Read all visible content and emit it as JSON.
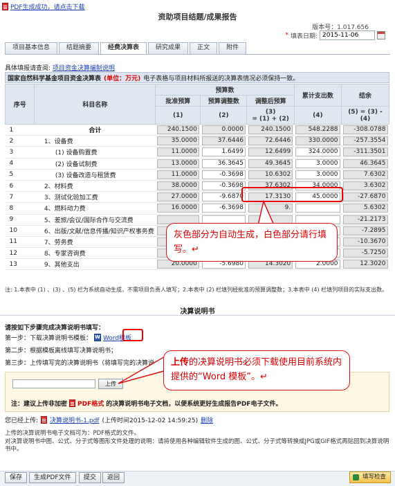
{
  "top_link": "PDF生成成功，请点击下载",
  "title": "资助项目结题/成果报告",
  "version": "版本号：1.017.656",
  "fill_date": {
    "required_mark": "*",
    "label": "填表日期:",
    "value": "2015-11-06"
  },
  "tabs": [
    "项目基本信息",
    "结题摘要",
    "经费决算表",
    "研究成果",
    "正文",
    "附件"
  ],
  "active_tab": 2,
  "guide": {
    "label": "具体填报请查阅:",
    "link": "项目资金决算编制说明"
  },
  "section": {
    "title": "国家自然科学基金项目资金决算表",
    "unit": "(单位：万元)",
    "desc": "电子表格与项目材料所报送的决算表情况必须保持一致。"
  },
  "table": {
    "headers": {
      "no": "序号",
      "name": "科目名称",
      "budget_group": "预算数",
      "approved": "批准预算",
      "adjust": "预算调整数",
      "adjusted": "调整后预算",
      "spent": "累计支出数",
      "balance": "结余",
      "c1": "(1)",
      "c2": "(2)",
      "c3a": "(3)",
      "c3b": "= (1) + (2)",
      "c4": "(4)",
      "c5a": "(5) = (3) -",
      "c5b": "(4)"
    },
    "rows": [
      {
        "no": "1",
        "name": "合计",
        "bold": true,
        "v": [
          "240.1500",
          "0.0000",
          "240.1500",
          "548.2288",
          "-308.0788"
        ],
        "t": [
          "g",
          "g",
          "g",
          "g",
          "g"
        ]
      },
      {
        "no": "2",
        "name": "1、设备费",
        "v": [
          "35.0000",
          "37.6446",
          "72.6446",
          "330.0000",
          "-257.3554"
        ],
        "t": [
          "g",
          "g",
          "g",
          "g",
          "g"
        ]
      },
      {
        "no": "3",
        "name": "(1) 设备购置费",
        "v": [
          "11.0000",
          "1.6499",
          "12.6499",
          "324.0000",
          "-311.3501"
        ],
        "t": [
          "g",
          "w",
          "g",
          "w",
          "g"
        ]
      },
      {
        "no": "4",
        "name": "(2) 设备试制费",
        "v": [
          "13.0000",
          "36.3645",
          "49.3645",
          "3.0000",
          "46.3645"
        ],
        "t": [
          "g",
          "w",
          "g",
          "w",
          "g"
        ]
      },
      {
        "no": "5",
        "name": "(3) 设备改造与租赁费",
        "v": [
          "11.0000",
          "-0.3698",
          "10.6302",
          "3.0000",
          "7.6302"
        ],
        "t": [
          "g",
          "w",
          "g",
          "w",
          "g"
        ]
      },
      {
        "no": "6",
        "name": "2、材料费",
        "v": [
          "38.0000",
          "-0.3698",
          "37.6302",
          "34.0000",
          "3.6302"
        ],
        "t": [
          "g",
          "w",
          "g",
          "w",
          "g"
        ]
      },
      {
        "no": "7",
        "name": "3、测试化验加工费",
        "v": [
          "27.0000",
          "-9.6870",
          "17.3130",
          "45.0000",
          "-27.6870"
        ],
        "t": [
          "g",
          "w",
          "g",
          "w",
          "g"
        ]
      },
      {
        "no": "8",
        "name": "4、燃料动力费",
        "v": [
          "16.0000",
          "-6.3698",
          "9.",
          "",
          "5.6302"
        ],
        "t": [
          "g",
          "w",
          "g",
          "w",
          "g"
        ]
      },
      {
        "no": "9",
        "name": "5、差旅/会议/国际合作与交流费",
        "v": [
          "",
          "",
          "",
          "",
          "-21.2173"
        ],
        "t": [
          "g",
          "w",
          "g",
          "w",
          "g"
        ]
      },
      {
        "no": "10",
        "name": "6、出版/文献/信息传播/知识产权事务费",
        "v": [
          "",
          "",
          "",
          "",
          "-7.2895"
        ],
        "t": [
          "g",
          "w",
          "g",
          "w",
          "g"
        ]
      },
      {
        "no": "11",
        "name": "7、劳务费",
        "v": [
          "",
          "",
          "",
          "",
          "-10.3670"
        ],
        "t": [
          "g",
          "w",
          "g",
          "w",
          "g"
        ]
      },
      {
        "no": "12",
        "name": "8、专家咨询费",
        "v": [
          "5.1500",
          "-9.8750",
          "-4.7250",
          "1.0000",
          "-5.7250"
        ],
        "t": [
          "g",
          "w",
          "g",
          "w",
          "g"
        ]
      },
      {
        "no": "13",
        "name": "9、其他支出",
        "v": [
          "20.0000",
          "-5.6980",
          "14.3020",
          "2.0000",
          "12.3020"
        ],
        "t": [
          "g",
          "w",
          "g",
          "w",
          "g"
        ]
      }
    ]
  },
  "table_note": "注: 1.本表中 (1) 、(3) 、(5) 栏为系统自动生成，不需项目负责人填写；2.本表中 (2) 栏填列经批准的预算调整数；3.本表中 (4) 栏填列项目的实际支出数。",
  "callout1": "灰色部分为自动生成，白色部分请行填写。↵",
  "desc_title": "决算说明书",
  "steps_title": "请按如下步骤完成决算说明书填写：",
  "step1": {
    "label": "第一步：下载决算说明书模板：",
    "link": "Word模板"
  },
  "step2": "第二步：根据模板离线填写决算说明书；",
  "step3": "第三步：上传填写完的决算说明书（将填写完的决算说",
  "callout2_red": "上传",
  "callout2": "的决算说明书必须下载使用目前系统内提供的“Word 模板”。↵",
  "upload": {
    "button": "上传",
    "note_prefix": "注：建议上传非加密",
    "note_red": "PDF格式",
    "note_suffix": "的决算说明书电子文档，以便系统更好生成报告PDF电子文件。"
  },
  "uploaded": {
    "label": "您已经上传:",
    "file": "决算说明书-1.pdf",
    "time": "(上传时间2015-12-02 14:59:25)",
    "delete": "删除"
  },
  "foot_note1": "上传的决算说明书电子文档可为：PDF格式的文件。",
  "foot_note2": "对决算说明书中图、公式、分子式等图形文件处理的说明：请将使用各种编辑软件生成的图、公式、分子式等转换成JPG或GIF格式再贴回到决算说明书中。",
  "buttons": {
    "save": "保存",
    "gen_pdf": "生成PDF文件",
    "submit": "提交",
    "back": "返回",
    "check": "填写检查"
  }
}
